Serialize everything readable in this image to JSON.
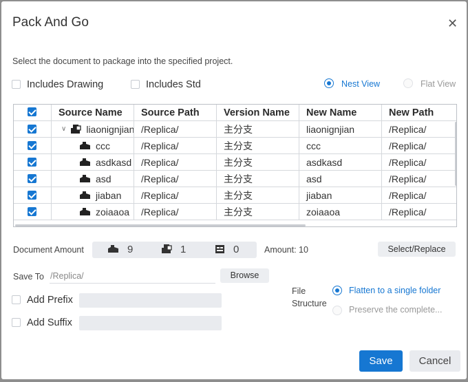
{
  "dialog": {
    "title": "Pack And Go",
    "subtitle": "Select the document to package into the specified project."
  },
  "options": {
    "includes_drawing": {
      "label": "Includes Drawing",
      "checked": false
    },
    "includes_std": {
      "label": "Includes Std",
      "checked": false
    }
  },
  "view": {
    "nest": {
      "label": "Nest View",
      "selected": true
    },
    "flat": {
      "label": "Flat View",
      "selected": false
    }
  },
  "table": {
    "columns": [
      "Source Name",
      "Source Path",
      "Version Name",
      "New Name",
      "New Path"
    ],
    "rows": [
      {
        "source_name": "liaonignjian",
        "source_path": "/Replica/",
        "version_name": "主分支",
        "new_name": "liaonignjian",
        "new_path": "/Replica/",
        "checked": true,
        "expanded": true,
        "type": "assembly"
      },
      {
        "source_name": "ccc",
        "source_path": "/Replica/",
        "version_name": "主分支",
        "new_name": "ccc",
        "new_path": "/Replica/",
        "checked": true,
        "type": "part"
      },
      {
        "source_name": "asdkasd",
        "source_path": "/Replica/",
        "version_name": "主分支",
        "new_name": "asdkasd",
        "new_path": "/Replica/",
        "checked": true,
        "type": "part"
      },
      {
        "source_name": "asd",
        "source_path": "/Replica/",
        "version_name": "主分支",
        "new_name": "asd",
        "new_path": "/Replica/",
        "checked": true,
        "type": "part"
      },
      {
        "source_name": "jiaban",
        "source_path": "/Replica/",
        "version_name": "主分支",
        "new_name": "jiaban",
        "new_path": "/Replica/",
        "checked": true,
        "type": "part"
      },
      {
        "source_name": "zoiaaoa",
        "source_path": "/Replica/",
        "version_name": "主分支",
        "new_name": "zoiaaoa",
        "new_path": "/Replica/",
        "checked": true,
        "type": "part"
      }
    ]
  },
  "amount": {
    "label": "Document Amount",
    "parts": "9",
    "assemblies": "1",
    "drawings": "0",
    "total": "Amount: 10",
    "select_replace": "Select/Replace"
  },
  "save_to": {
    "label": "Save To",
    "value": "/Replica/",
    "browse": "Browse"
  },
  "prefix": {
    "label": "Add Prefix",
    "value": "",
    "checked": false
  },
  "suffix": {
    "label": "Add Suffix",
    "value": "",
    "checked": false
  },
  "file_structure": {
    "label_line1": "File",
    "label_line2": "Structure",
    "flatten": "Flatten to a single folder",
    "preserve": "Preserve the complete..."
  },
  "buttons": {
    "save": "Save",
    "cancel": "Cancel"
  },
  "colors": {
    "accent": "#1677d2",
    "panel": "#e9ebef",
    "overlay": "#8e8e8e"
  }
}
